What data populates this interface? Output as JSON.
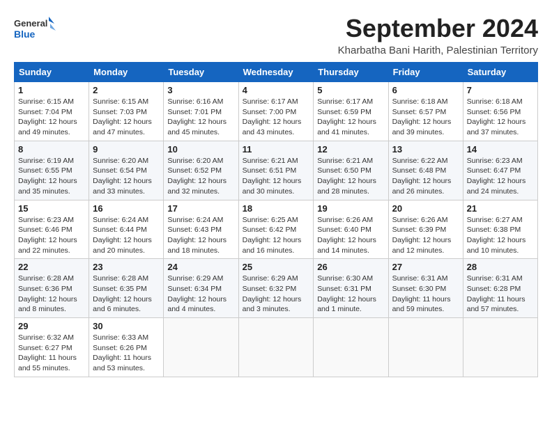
{
  "header": {
    "logo_line1": "General",
    "logo_line2": "Blue",
    "month": "September 2024",
    "location": "Kharbatha Bani Harith, Palestinian Territory"
  },
  "weekdays": [
    "Sunday",
    "Monday",
    "Tuesday",
    "Wednesday",
    "Thursday",
    "Friday",
    "Saturday"
  ],
  "weeks": [
    [
      {
        "day": "1",
        "info": "Sunrise: 6:15 AM\nSunset: 7:04 PM\nDaylight: 12 hours\nand 49 minutes."
      },
      {
        "day": "2",
        "info": "Sunrise: 6:15 AM\nSunset: 7:03 PM\nDaylight: 12 hours\nand 47 minutes."
      },
      {
        "day": "3",
        "info": "Sunrise: 6:16 AM\nSunset: 7:01 PM\nDaylight: 12 hours\nand 45 minutes."
      },
      {
        "day": "4",
        "info": "Sunrise: 6:17 AM\nSunset: 7:00 PM\nDaylight: 12 hours\nand 43 minutes."
      },
      {
        "day": "5",
        "info": "Sunrise: 6:17 AM\nSunset: 6:59 PM\nDaylight: 12 hours\nand 41 minutes."
      },
      {
        "day": "6",
        "info": "Sunrise: 6:18 AM\nSunset: 6:57 PM\nDaylight: 12 hours\nand 39 minutes."
      },
      {
        "day": "7",
        "info": "Sunrise: 6:18 AM\nSunset: 6:56 PM\nDaylight: 12 hours\nand 37 minutes."
      }
    ],
    [
      {
        "day": "8",
        "info": "Sunrise: 6:19 AM\nSunset: 6:55 PM\nDaylight: 12 hours\nand 35 minutes."
      },
      {
        "day": "9",
        "info": "Sunrise: 6:20 AM\nSunset: 6:54 PM\nDaylight: 12 hours\nand 33 minutes."
      },
      {
        "day": "10",
        "info": "Sunrise: 6:20 AM\nSunset: 6:52 PM\nDaylight: 12 hours\nand 32 minutes."
      },
      {
        "day": "11",
        "info": "Sunrise: 6:21 AM\nSunset: 6:51 PM\nDaylight: 12 hours\nand 30 minutes."
      },
      {
        "day": "12",
        "info": "Sunrise: 6:21 AM\nSunset: 6:50 PM\nDaylight: 12 hours\nand 28 minutes."
      },
      {
        "day": "13",
        "info": "Sunrise: 6:22 AM\nSunset: 6:48 PM\nDaylight: 12 hours\nand 26 minutes."
      },
      {
        "day": "14",
        "info": "Sunrise: 6:23 AM\nSunset: 6:47 PM\nDaylight: 12 hours\nand 24 minutes."
      }
    ],
    [
      {
        "day": "15",
        "info": "Sunrise: 6:23 AM\nSunset: 6:46 PM\nDaylight: 12 hours\nand 22 minutes."
      },
      {
        "day": "16",
        "info": "Sunrise: 6:24 AM\nSunset: 6:44 PM\nDaylight: 12 hours\nand 20 minutes."
      },
      {
        "day": "17",
        "info": "Sunrise: 6:24 AM\nSunset: 6:43 PM\nDaylight: 12 hours\nand 18 minutes."
      },
      {
        "day": "18",
        "info": "Sunrise: 6:25 AM\nSunset: 6:42 PM\nDaylight: 12 hours\nand 16 minutes."
      },
      {
        "day": "19",
        "info": "Sunrise: 6:26 AM\nSunset: 6:40 PM\nDaylight: 12 hours\nand 14 minutes."
      },
      {
        "day": "20",
        "info": "Sunrise: 6:26 AM\nSunset: 6:39 PM\nDaylight: 12 hours\nand 12 minutes."
      },
      {
        "day": "21",
        "info": "Sunrise: 6:27 AM\nSunset: 6:38 PM\nDaylight: 12 hours\nand 10 minutes."
      }
    ],
    [
      {
        "day": "22",
        "info": "Sunrise: 6:28 AM\nSunset: 6:36 PM\nDaylight: 12 hours\nand 8 minutes."
      },
      {
        "day": "23",
        "info": "Sunrise: 6:28 AM\nSunset: 6:35 PM\nDaylight: 12 hours\nand 6 minutes."
      },
      {
        "day": "24",
        "info": "Sunrise: 6:29 AM\nSunset: 6:34 PM\nDaylight: 12 hours\nand 4 minutes."
      },
      {
        "day": "25",
        "info": "Sunrise: 6:29 AM\nSunset: 6:32 PM\nDaylight: 12 hours\nand 3 minutes."
      },
      {
        "day": "26",
        "info": "Sunrise: 6:30 AM\nSunset: 6:31 PM\nDaylight: 12 hours\nand 1 minute."
      },
      {
        "day": "27",
        "info": "Sunrise: 6:31 AM\nSunset: 6:30 PM\nDaylight: 11 hours\nand 59 minutes."
      },
      {
        "day": "28",
        "info": "Sunrise: 6:31 AM\nSunset: 6:28 PM\nDaylight: 11 hours\nand 57 minutes."
      }
    ],
    [
      {
        "day": "29",
        "info": "Sunrise: 6:32 AM\nSunset: 6:27 PM\nDaylight: 11 hours\nand 55 minutes."
      },
      {
        "day": "30",
        "info": "Sunrise: 6:33 AM\nSunset: 6:26 PM\nDaylight: 11 hours\nand 53 minutes."
      },
      {
        "day": "",
        "info": ""
      },
      {
        "day": "",
        "info": ""
      },
      {
        "day": "",
        "info": ""
      },
      {
        "day": "",
        "info": ""
      },
      {
        "day": "",
        "info": ""
      }
    ]
  ]
}
